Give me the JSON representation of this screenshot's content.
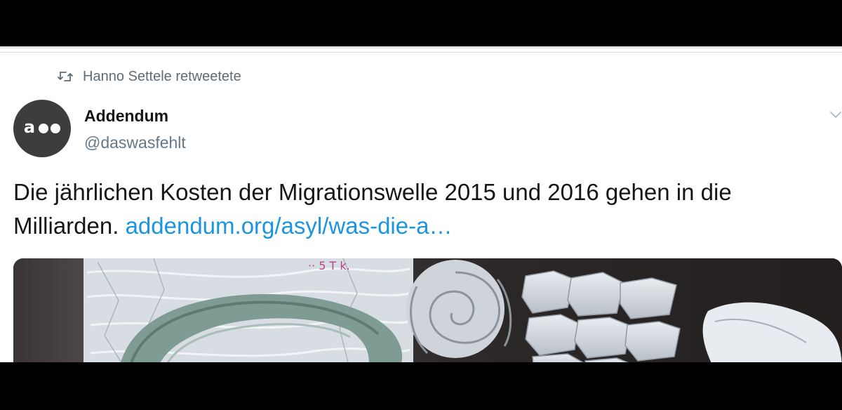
{
  "retweet": {
    "icon": "retweet-icon",
    "label": "Hanno Settele retweetete"
  },
  "author": {
    "avatar_icon": "addendum-logo",
    "avatar_text": "a",
    "display_name": "Addendum",
    "handle": "@daswasfehlt"
  },
  "tweet": {
    "text_line1": "Die jährlichen Kosten der Migrationswelle 2015 und 2016 gehen in die",
    "text_line2": "Milliarden.",
    "link": "addendum.org/asyl/was-die-a…"
  },
  "menu_icon": "chevron-down-icon",
  "media": {
    "description_icon": "photo-image",
    "handwriting": "·· 5 T k."
  },
  "colors": {
    "link": "#1b95e0",
    "secondary_text": "#657786",
    "avatar_bg": "#3d3d3d"
  }
}
